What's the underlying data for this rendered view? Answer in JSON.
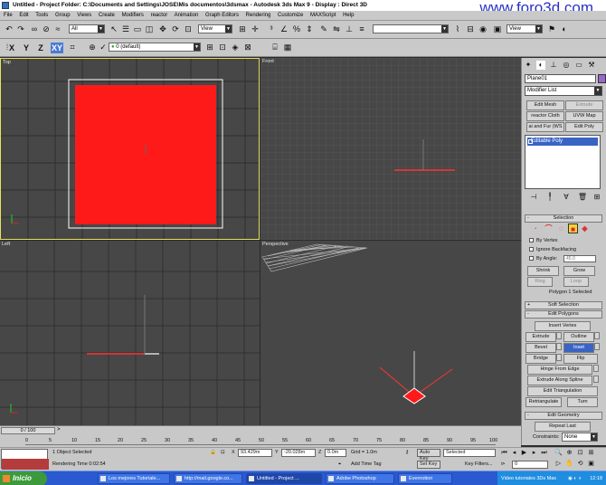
{
  "window": {
    "title": "Untitled    - Project Folder: C:\\Documents and Settings\\JOSE\\Mis documentos\\3dsmax    - Autodesk 3ds Max 9    - Display : Direct 3D",
    "watermark": "www.foro3d.com"
  },
  "menu": [
    "File",
    "Edit",
    "Tools",
    "Group",
    "Views",
    "Create",
    "Modifiers",
    "reactor",
    "Animation",
    "Graph Editors",
    "Rendering",
    "Customize",
    "MAXScript",
    "Help"
  ],
  "toolbar1": {
    "selection_filter": "All",
    "ref_coord": "View",
    "ref_coord2": "View"
  },
  "toolbar2": {
    "axes": [
      "X",
      "Y",
      "Z",
      "XY"
    ],
    "layer": "0 (default)"
  },
  "viewports": {
    "top": "Top",
    "front": "Front",
    "left": "Left",
    "perspective": "Perspective"
  },
  "command_panel": {
    "object_name": "Plane01",
    "modifier_list": "Modifier List",
    "buttons": {
      "edit_mesh": "Edit Mesh",
      "extrude": "Extrude",
      "reactor_cloth": "reactor Cloth",
      "uvw_map": "UVW Map",
      "ur_fur": "ai and Fur (WS",
      "edit_poly_btn": "Edit Poly"
    },
    "stack_item": "Editable Poly",
    "selection": {
      "title": "Selection",
      "by_vertex": "By Vertex",
      "ignore_backfacing": "Ignore Backfacing",
      "by_angle": "By Angle:",
      "by_angle_value": "45.0",
      "shrink": "Shrink",
      "grow": "Grow",
      "ring": "Ring",
      "loop": "Loop",
      "status": "Polygon 1 Selected"
    },
    "soft_selection": "Soft Selection",
    "edit_polygons": {
      "title": "Edit Polygons",
      "insert_vertex": "Insert Vertex",
      "extrude": "Extrude",
      "outline": "Outline",
      "bevel": "Bevel",
      "inset": "Inset",
      "bridge": "Bridge",
      "flip": "Flip",
      "hinge_from_edge": "Hinge From Edge",
      "extrude_along_spline": "Extrude Along Spline",
      "edit_triangulation": "Edit Triangulation",
      "retriangulate": "Retriangulate",
      "turn": "Turn"
    },
    "edit_geometry": {
      "title": "Edit Geometry",
      "repeat_last": "Repeat Last",
      "constraints": "Constraints:",
      "constraints_value": "None"
    }
  },
  "timeline": {
    "slider": "0 / 100",
    "ticks": [
      "0",
      "5",
      "10",
      "15",
      "20",
      "25",
      "30",
      "35",
      "40",
      "45",
      "50",
      "55",
      "60",
      "65",
      "70",
      "75",
      "80",
      "85",
      "90",
      "95",
      "100"
    ]
  },
  "status": {
    "selected": "1 Object Selected",
    "render_time": "Rendering Time  0:02:54",
    "x_label": "X",
    "x_value": "93.429m",
    "y_label": "Y",
    "y_value": "-20.028m",
    "z_label": "Z",
    "z_value": "0.0m",
    "grid": "Grid = 1.0m",
    "add_time_tag": "Add Time Tag",
    "auto_key": "Auto Key",
    "auto_key_sel": "Selected",
    "set_key": "Set Key",
    "key_filters": "Key Filters...",
    "frame": "0"
  },
  "taskbar": {
    "start": "Inicio",
    "tasks": [
      "Los mejores Tutoriale...",
      "http://mail.google.co...",
      "Untitled    - Project ...",
      "Adobe Photoshop",
      "Evernotion"
    ],
    "tray_item": "Video tutoriales 3Ds Max",
    "clock": "12:18"
  },
  "colors": {
    "plane_red": "#ff1a1a",
    "viewport_bg": "#474747",
    "grid_line": "#2e2e2e",
    "selection_blue": "#3a64c4",
    "object_color": "#9966cc"
  }
}
